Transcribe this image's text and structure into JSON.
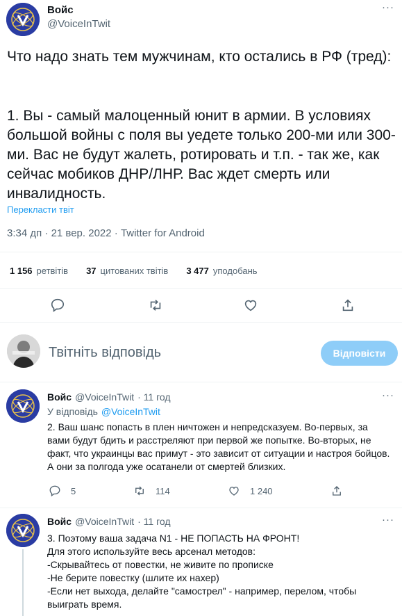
{
  "main_tweet": {
    "author_name": "Войс",
    "author_handle": "@VoiceInTwit",
    "text_intro": "Что надо знать тем мужчинам, кто остались в РФ (тред):",
    "text_point1": "1. Вы - самый малоценный юнит в армии. В условиях большой войны с поля вы уедете только 200-ми или 300-ми. Вас не будут жалеть, ротировать и т.п. - так же, как сейчас мобиков ДНР/ЛНР. Вас ждет смерть или инвалидность.",
    "translate_link": "Перекласти твіт",
    "timestamp": "3:34 дп · 21 вер. 2022 · Twitter for Android",
    "stats": {
      "retweets_count": "1 156",
      "retweets_label": "ретвітів",
      "quotes_count": "37",
      "quotes_label": "цитованих твітів",
      "likes_count": "3 477",
      "likes_label": "уподобань"
    }
  },
  "composer": {
    "placeholder": "Твітніть відповідь",
    "reply_button": "Відповісти"
  },
  "replies": [
    {
      "author_name": "Войс",
      "author_handle": "@VoiceInTwit",
      "time": "· 11 год",
      "replying_prefix": "У відповідь",
      "replying_to": "@VoiceInTwit",
      "text": "2. Ваш шанс попасть в плен ничтожен и непредсказуем. Во-первых, за вами будут бдить и расстреляют при первой же попытке. Во-вторых, не факт, что украинцы вас примут - это зависит от ситуации и настроя бойцов. А они за полгода уже осатанели от смертей близких.",
      "reply_count": "5",
      "retweet_count": "114",
      "like_count": "1 240"
    },
    {
      "author_name": "Войс",
      "author_handle": "@VoiceInTwit",
      "time": "· 11 год",
      "lines": [
        "3. Поэтому ваша задача N1 - НЕ ПОПАСТЬ НА ФРОНТ!",
        "Для этого используйте весь арсенал методов:",
        "-Скрывайтесь от повестки, не живите по прописке",
        "-Не берите повестку (шлите их нахер)",
        "-Если нет выхода, делайте \"самострел\" - например, перелом, чтобы",
        "выиграть время."
      ]
    }
  ],
  "colors": {
    "accent": "#1d9bf0",
    "reply_button_bg": "#8ecdf8",
    "text": "#0f1419",
    "muted": "#536471",
    "divider": "#eff3f4",
    "avatar_bg": "#2b3aa0"
  }
}
